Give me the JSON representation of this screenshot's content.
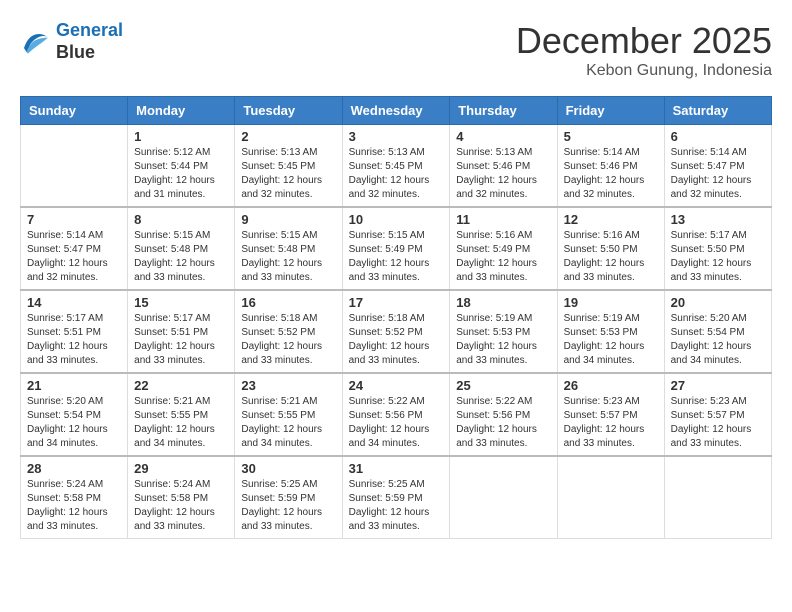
{
  "header": {
    "logo_line1": "General",
    "logo_line2": "Blue",
    "month_year": "December 2025",
    "location": "Kebon Gunung, Indonesia"
  },
  "columns": [
    "Sunday",
    "Monday",
    "Tuesday",
    "Wednesday",
    "Thursday",
    "Friday",
    "Saturday"
  ],
  "weeks": [
    [
      {
        "day": "",
        "info": ""
      },
      {
        "day": "1",
        "info": "Sunrise: 5:12 AM\nSunset: 5:44 PM\nDaylight: 12 hours\nand 31 minutes."
      },
      {
        "day": "2",
        "info": "Sunrise: 5:13 AM\nSunset: 5:45 PM\nDaylight: 12 hours\nand 32 minutes."
      },
      {
        "day": "3",
        "info": "Sunrise: 5:13 AM\nSunset: 5:45 PM\nDaylight: 12 hours\nand 32 minutes."
      },
      {
        "day": "4",
        "info": "Sunrise: 5:13 AM\nSunset: 5:46 PM\nDaylight: 12 hours\nand 32 minutes."
      },
      {
        "day": "5",
        "info": "Sunrise: 5:14 AM\nSunset: 5:46 PM\nDaylight: 12 hours\nand 32 minutes."
      },
      {
        "day": "6",
        "info": "Sunrise: 5:14 AM\nSunset: 5:47 PM\nDaylight: 12 hours\nand 32 minutes."
      }
    ],
    [
      {
        "day": "7",
        "info": "Sunrise: 5:14 AM\nSunset: 5:47 PM\nDaylight: 12 hours\nand 32 minutes."
      },
      {
        "day": "8",
        "info": "Sunrise: 5:15 AM\nSunset: 5:48 PM\nDaylight: 12 hours\nand 33 minutes."
      },
      {
        "day": "9",
        "info": "Sunrise: 5:15 AM\nSunset: 5:48 PM\nDaylight: 12 hours\nand 33 minutes."
      },
      {
        "day": "10",
        "info": "Sunrise: 5:15 AM\nSunset: 5:49 PM\nDaylight: 12 hours\nand 33 minutes."
      },
      {
        "day": "11",
        "info": "Sunrise: 5:16 AM\nSunset: 5:49 PM\nDaylight: 12 hours\nand 33 minutes."
      },
      {
        "day": "12",
        "info": "Sunrise: 5:16 AM\nSunset: 5:50 PM\nDaylight: 12 hours\nand 33 minutes."
      },
      {
        "day": "13",
        "info": "Sunrise: 5:17 AM\nSunset: 5:50 PM\nDaylight: 12 hours\nand 33 minutes."
      }
    ],
    [
      {
        "day": "14",
        "info": "Sunrise: 5:17 AM\nSunset: 5:51 PM\nDaylight: 12 hours\nand 33 minutes."
      },
      {
        "day": "15",
        "info": "Sunrise: 5:17 AM\nSunset: 5:51 PM\nDaylight: 12 hours\nand 33 minutes."
      },
      {
        "day": "16",
        "info": "Sunrise: 5:18 AM\nSunset: 5:52 PM\nDaylight: 12 hours\nand 33 minutes."
      },
      {
        "day": "17",
        "info": "Sunrise: 5:18 AM\nSunset: 5:52 PM\nDaylight: 12 hours\nand 33 minutes."
      },
      {
        "day": "18",
        "info": "Sunrise: 5:19 AM\nSunset: 5:53 PM\nDaylight: 12 hours\nand 33 minutes."
      },
      {
        "day": "19",
        "info": "Sunrise: 5:19 AM\nSunset: 5:53 PM\nDaylight: 12 hours\nand 34 minutes."
      },
      {
        "day": "20",
        "info": "Sunrise: 5:20 AM\nSunset: 5:54 PM\nDaylight: 12 hours\nand 34 minutes."
      }
    ],
    [
      {
        "day": "21",
        "info": "Sunrise: 5:20 AM\nSunset: 5:54 PM\nDaylight: 12 hours\nand 34 minutes."
      },
      {
        "day": "22",
        "info": "Sunrise: 5:21 AM\nSunset: 5:55 PM\nDaylight: 12 hours\nand 34 minutes."
      },
      {
        "day": "23",
        "info": "Sunrise: 5:21 AM\nSunset: 5:55 PM\nDaylight: 12 hours\nand 34 minutes."
      },
      {
        "day": "24",
        "info": "Sunrise: 5:22 AM\nSunset: 5:56 PM\nDaylight: 12 hours\nand 34 minutes."
      },
      {
        "day": "25",
        "info": "Sunrise: 5:22 AM\nSunset: 5:56 PM\nDaylight: 12 hours\nand 33 minutes."
      },
      {
        "day": "26",
        "info": "Sunrise: 5:23 AM\nSunset: 5:57 PM\nDaylight: 12 hours\nand 33 minutes."
      },
      {
        "day": "27",
        "info": "Sunrise: 5:23 AM\nSunset: 5:57 PM\nDaylight: 12 hours\nand 33 minutes."
      }
    ],
    [
      {
        "day": "28",
        "info": "Sunrise: 5:24 AM\nSunset: 5:58 PM\nDaylight: 12 hours\nand 33 minutes."
      },
      {
        "day": "29",
        "info": "Sunrise: 5:24 AM\nSunset: 5:58 PM\nDaylight: 12 hours\nand 33 minutes."
      },
      {
        "day": "30",
        "info": "Sunrise: 5:25 AM\nSunset: 5:59 PM\nDaylight: 12 hours\nand 33 minutes."
      },
      {
        "day": "31",
        "info": "Sunrise: 5:25 AM\nSunset: 5:59 PM\nDaylight: 12 hours\nand 33 minutes."
      },
      {
        "day": "",
        "info": ""
      },
      {
        "day": "",
        "info": ""
      },
      {
        "day": "",
        "info": ""
      }
    ]
  ]
}
